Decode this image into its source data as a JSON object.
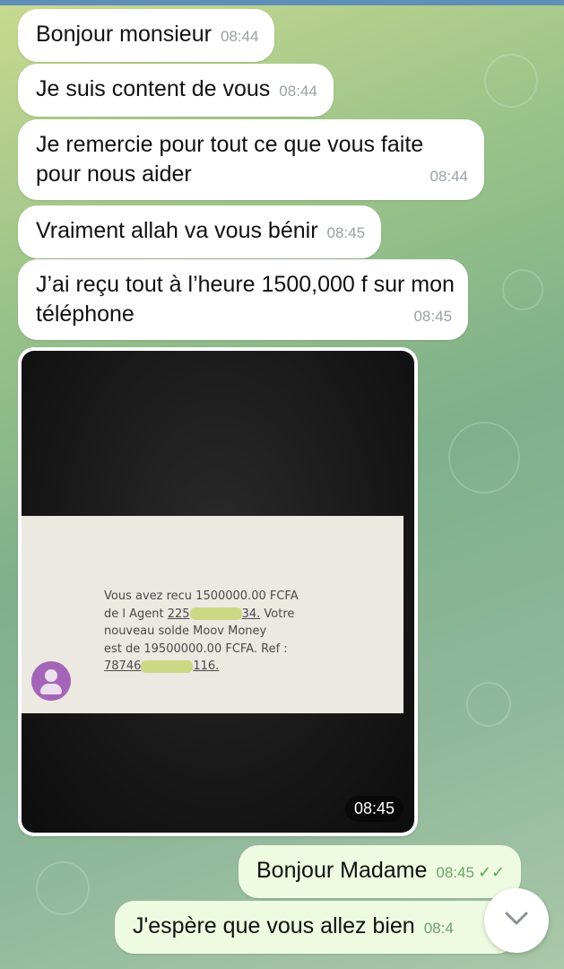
{
  "chat": {
    "incoming": [
      {
        "text": "Bonjour monsieur",
        "time": "08:44"
      },
      {
        "text": "Je suis content de vous",
        "time": "08:44"
      },
      {
        "text": "Je remercie pour tout ce que vous faite pour nous aider",
        "time": "08:44"
      },
      {
        "text": "Vraiment allah va vous bénir",
        "time": "08:45"
      },
      {
        "text": "J’ai reçu tout à l’heure 1500,000 f sur mon téléphone",
        "time": "08:45"
      }
    ],
    "photo": {
      "time": "08:45",
      "sms": {
        "line1": "Vous avez recu 1500000.00 FCFA",
        "line2_prefix": "de l Agent ",
        "agent_start": "225",
        "agent_end": "34.",
        "line2_suffix": " Votre",
        "line3": "nouveau solde Moov Money",
        "line4": "est de 19500000.00 FCFA. Ref :",
        "ref_start": "78746",
        "ref_end": "116."
      }
    },
    "outgoing": [
      {
        "text": "Bonjour Madame",
        "time": "08:45",
        "status": "read"
      },
      {
        "text": "J'espère que vous allez bien",
        "time": "08:4"
      }
    ]
  },
  "icons": {
    "read_receipt": "double-check-icon",
    "scroll_down": "chevron-down-icon",
    "sms_avatar": "person-avatar-icon"
  },
  "colors": {
    "incoming_bubble": "#ffffff",
    "outgoing_bubble": "#eefbe0",
    "read_tick": "#5aa85a",
    "avatar": "#a465b8"
  }
}
